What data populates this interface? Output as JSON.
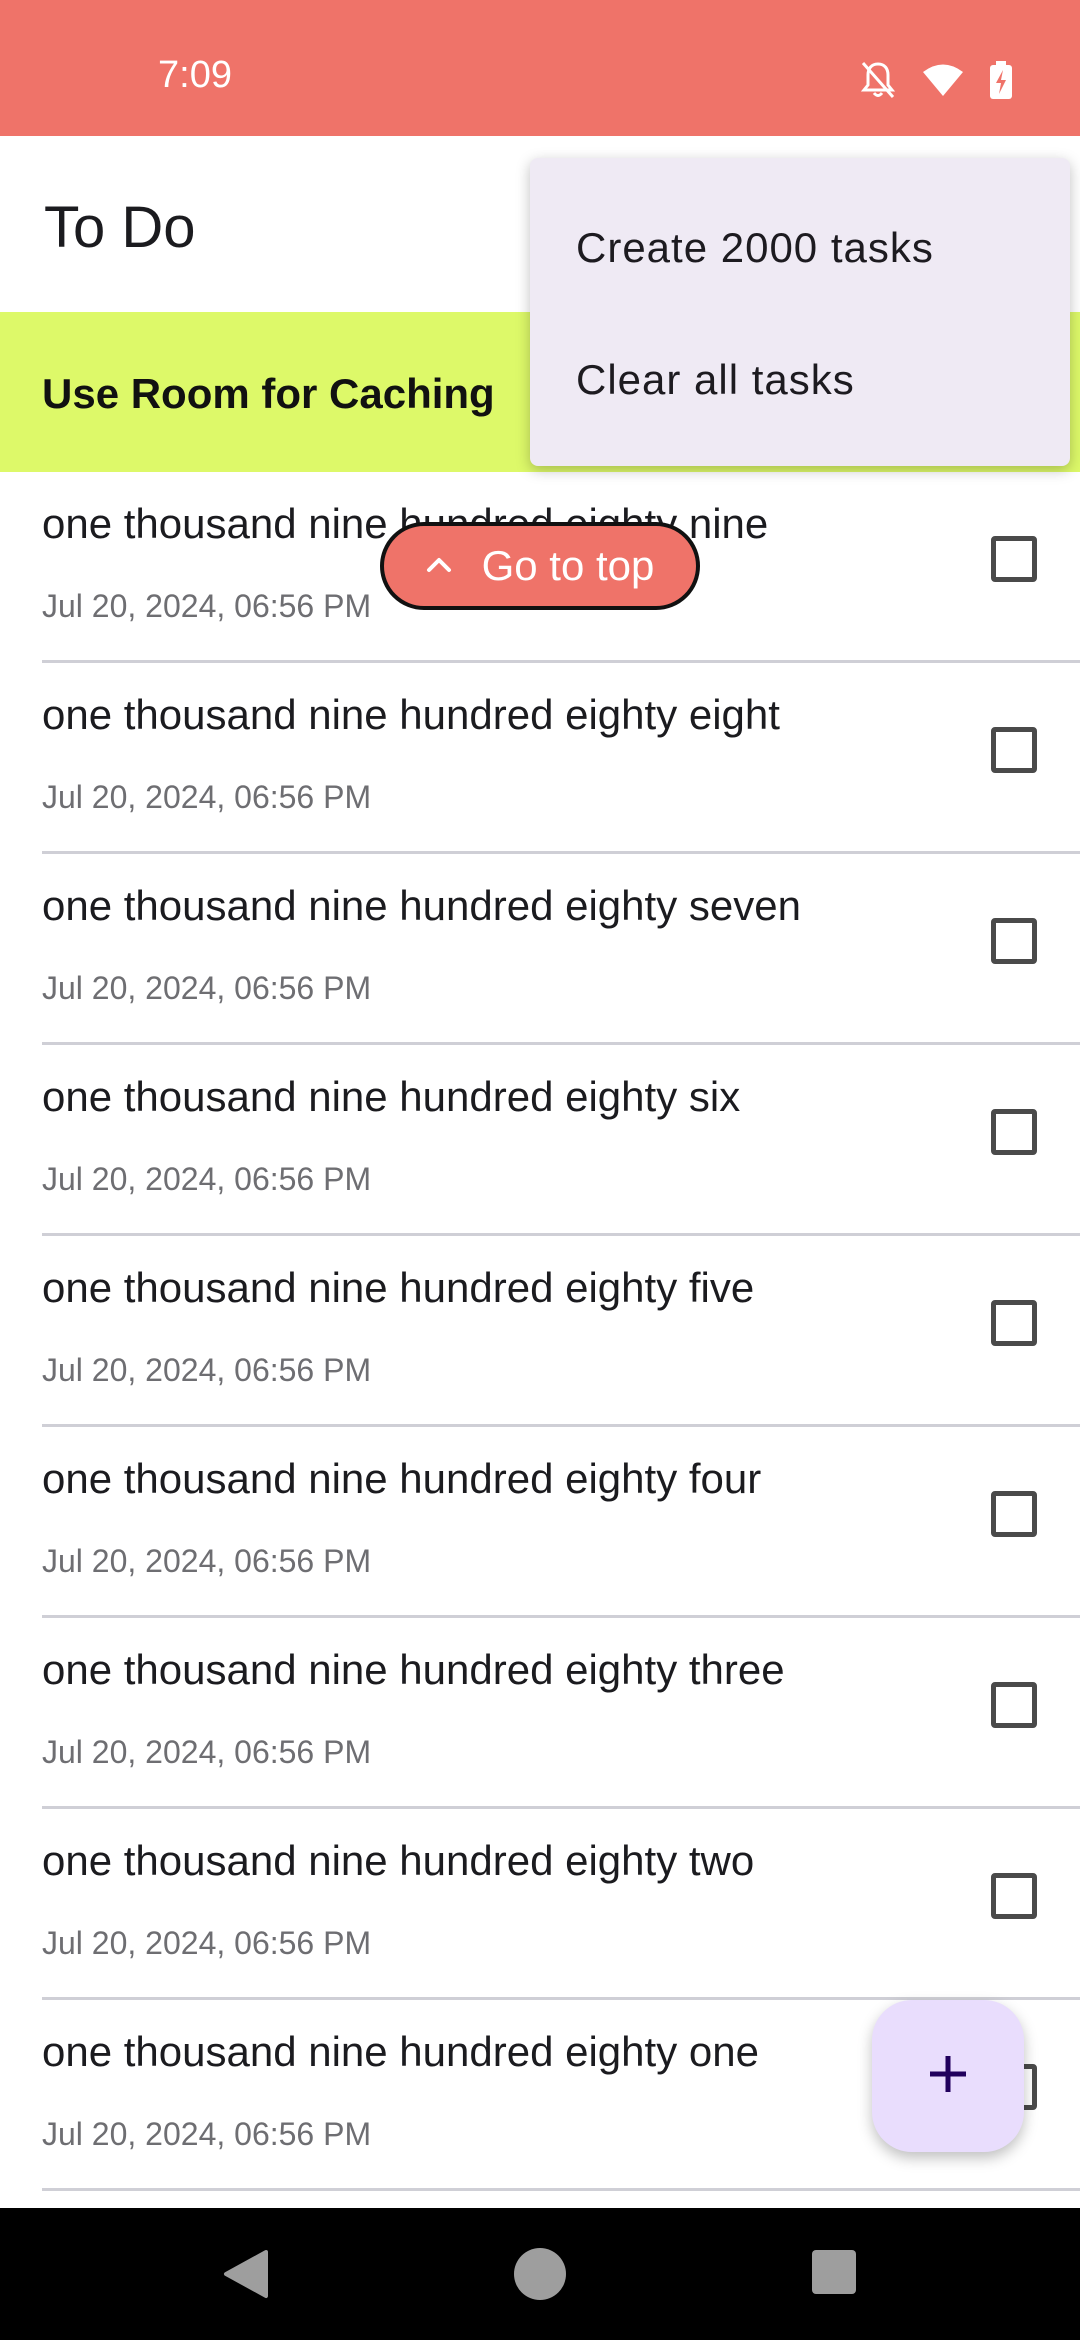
{
  "status_bar": {
    "time": "7:09",
    "icons": [
      "notifications-off-icon",
      "wifi-icon",
      "battery-charging-icon"
    ]
  },
  "app_bar": {
    "title": "To Do"
  },
  "banner": {
    "label": "Use Room for Caching"
  },
  "go_to_top": {
    "label": "Go to top",
    "icon": "chevron-up-icon"
  },
  "menu": {
    "items": [
      {
        "label": "Create 2000 tasks"
      },
      {
        "label": "Clear all tasks"
      }
    ]
  },
  "tasks": [
    {
      "title": "one thousand nine hundred eighty nine",
      "date": "Jul 20, 2024, 06:56 PM",
      "checked": false
    },
    {
      "title": "one thousand nine hundred eighty eight",
      "date": "Jul 20, 2024, 06:56 PM",
      "checked": false
    },
    {
      "title": "one thousand nine hundred eighty seven",
      "date": "Jul 20, 2024, 06:56 PM",
      "checked": false
    },
    {
      "title": "one thousand nine hundred eighty six",
      "date": "Jul 20, 2024, 06:56 PM",
      "checked": false
    },
    {
      "title": "one thousand nine hundred eighty five",
      "date": "Jul 20, 2024, 06:56 PM",
      "checked": false
    },
    {
      "title": "one thousand nine hundred eighty four",
      "date": "Jul 20, 2024, 06:56 PM",
      "checked": false
    },
    {
      "title": "one thousand nine hundred eighty three",
      "date": "Jul 20, 2024, 06:56 PM",
      "checked": false
    },
    {
      "title": "one thousand nine hundred eighty two",
      "date": "Jul 20, 2024, 06:56 PM",
      "checked": false
    },
    {
      "title": "one thousand nine hundred eighty one",
      "date": "Jul 20, 2024, 06:56 PM",
      "checked": false
    }
  ],
  "fab": {
    "icon": "add-icon"
  },
  "nav_bar": {
    "icons": [
      "back-icon",
      "home-icon",
      "recents-icon"
    ]
  },
  "colors": {
    "status_bar": "#EF7369",
    "banner": "#DDF969",
    "menu_bg": "#EFEAF4",
    "fab_bg": "#E9DDFD",
    "fab_icon": "#21005D"
  }
}
